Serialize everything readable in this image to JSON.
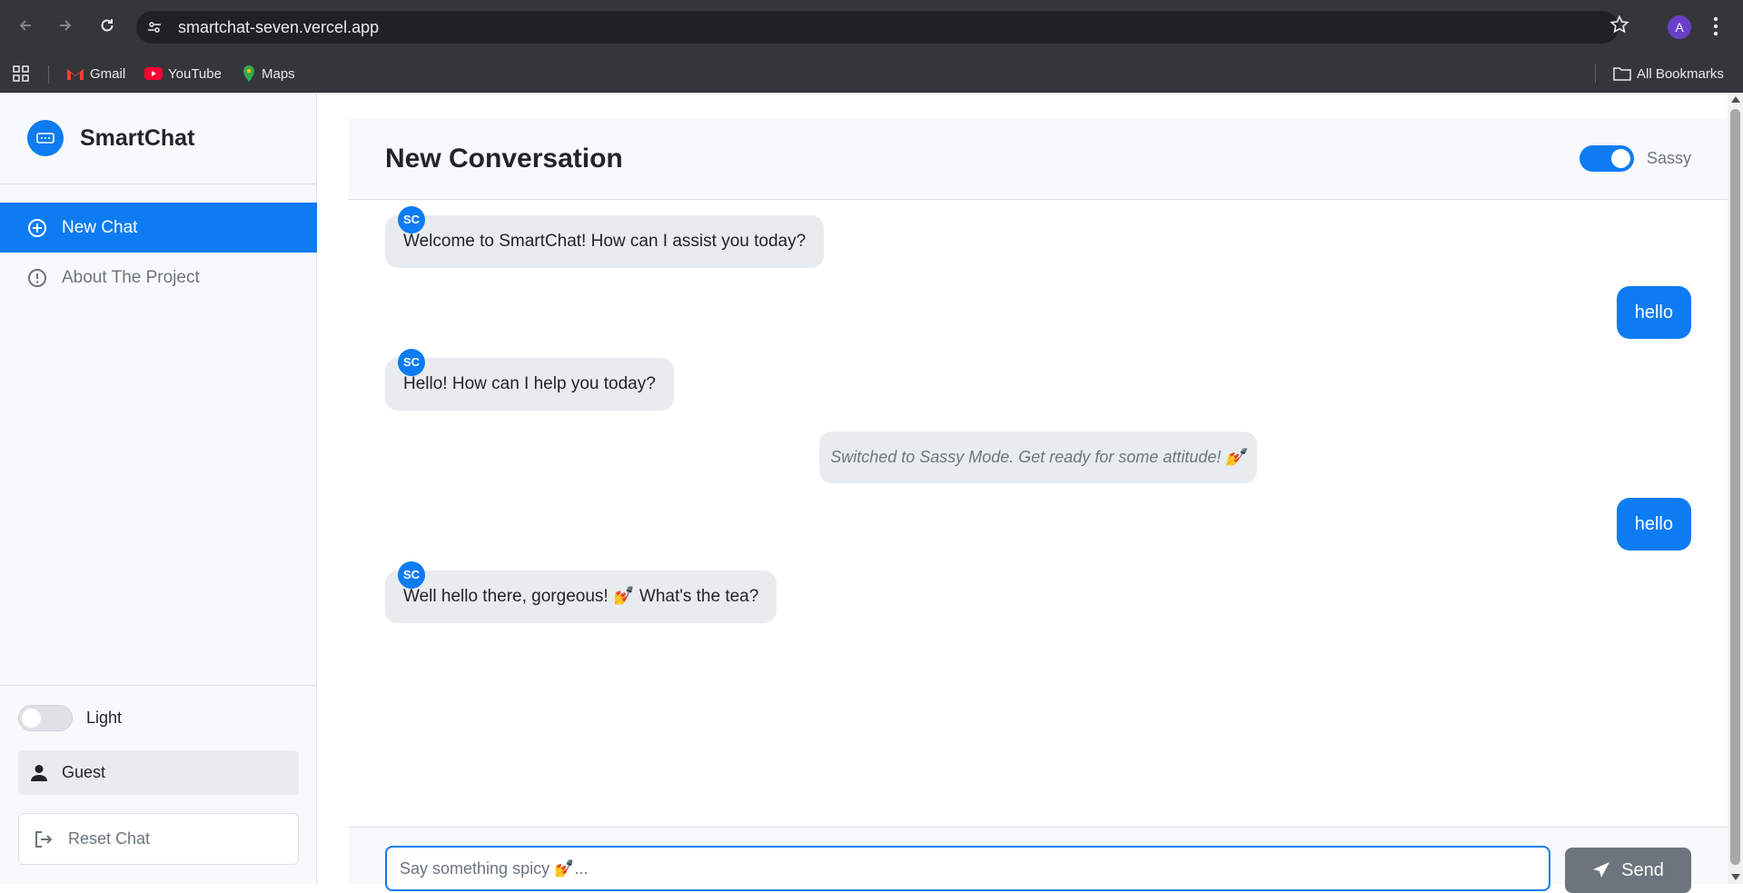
{
  "browser": {
    "url": "smartchat-seven.vercel.app",
    "profile_initial": "A",
    "bookmarks": [
      {
        "label": "Gmail",
        "icon": "gmail-icon"
      },
      {
        "label": "YouTube",
        "icon": "youtube-icon"
      },
      {
        "label": "Maps",
        "icon": "maps-icon"
      }
    ],
    "all_bookmarks_label": "All Bookmarks"
  },
  "sidebar": {
    "brand_name": "SmartChat",
    "items": [
      {
        "label": "New Chat",
        "icon": "plus-circle-icon",
        "active": true
      },
      {
        "label": "About The Project",
        "icon": "info-circle-icon",
        "active": false
      }
    ],
    "theme_label": "Light",
    "theme_dark_enabled": false,
    "user_label": "Guest",
    "reset_label": "Reset Chat"
  },
  "conversation": {
    "title": "New Conversation",
    "mode_label": "Sassy",
    "mode_enabled": true,
    "messages": [
      {
        "role": "bot",
        "avatar": "SC",
        "text": "Welcome to SmartChat! How can I assist you today?"
      },
      {
        "role": "user",
        "text": "hello"
      },
      {
        "role": "bot",
        "avatar": "SC",
        "text": "Hello! How can I help you today?"
      },
      {
        "role": "system",
        "text": "Switched to Sassy Mode. Get ready for some attitude! 💅"
      },
      {
        "role": "user",
        "text": "hello"
      },
      {
        "role": "bot",
        "avatar": "SC",
        "text": "Well hello there, gorgeous! 💅 What's the tea?"
      }
    ]
  },
  "composer": {
    "placeholder": "Say something spicy 💅...",
    "value": "",
    "send_label": "Send"
  },
  "colors": {
    "accent": "#0d7cf2",
    "bubble_bot": "#e9ecef",
    "send_disabled": "#6c757d"
  }
}
